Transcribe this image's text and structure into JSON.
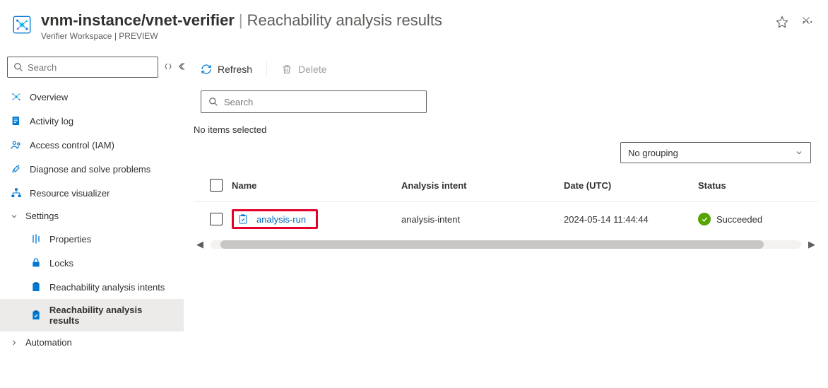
{
  "header": {
    "resource": "vnm-instance/vnet-verifier",
    "pageTitle": "Reachability analysis results",
    "subtitle": "Verifier Workspace | PREVIEW"
  },
  "sidebar": {
    "searchPlaceholder": "Search",
    "items": {
      "overview": "Overview",
      "activity": "Activity log",
      "iam": "Access control (IAM)",
      "diagnose": "Diagnose and solve problems",
      "resviz": "Resource visualizer",
      "settings": "Settings",
      "properties": "Properties",
      "locks": "Locks",
      "intents": "Reachability analysis intents",
      "results": "Reachability analysis results",
      "automation": "Automation"
    }
  },
  "toolbar": {
    "refresh": "Refresh",
    "delete": "Delete",
    "searchPlaceholder": "Search",
    "selectionText": "No items selected",
    "groupingValue": "No grouping"
  },
  "table": {
    "headers": {
      "name": "Name",
      "intent": "Analysis intent",
      "date": "Date (UTC)",
      "status": "Status"
    },
    "rows": [
      {
        "name": "analysis-run",
        "intent": "analysis-intent",
        "date": "2024-05-14 11:44:44",
        "status": "Succeeded"
      }
    ]
  }
}
